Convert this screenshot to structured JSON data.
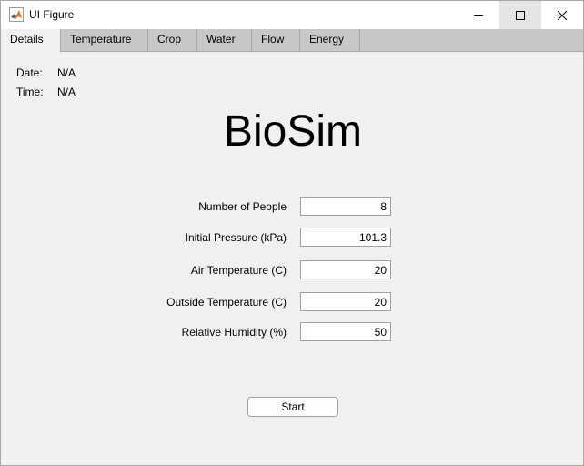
{
  "window": {
    "title": "UI Figure",
    "icon": "matlab-icon"
  },
  "tabs": [
    {
      "label": "Details",
      "active": true
    },
    {
      "label": "Temperature",
      "active": false
    },
    {
      "label": "Crop",
      "active": false
    },
    {
      "label": "Water",
      "active": false
    },
    {
      "label": "Flow",
      "active": false
    },
    {
      "label": "Energy",
      "active": false
    }
  ],
  "details": {
    "date_label": "Date:",
    "date_value": "N/A",
    "time_label": "Time:",
    "time_value": "N/A",
    "heading": "BioSim",
    "fields": [
      {
        "label": "Number of People",
        "value": "8"
      },
      {
        "label": "Initial Pressure (kPa)",
        "value": "101.3"
      },
      {
        "label": "Air Temperature (C)",
        "value": "20"
      },
      {
        "label": "Outside Temperature (C)",
        "value": "20"
      },
      {
        "label": "Relative Humidity (%)",
        "value": "50"
      }
    ],
    "start_label": "Start"
  },
  "colors": {
    "background": "#f0f0f0",
    "tabbar": "#c8c8c8",
    "border": "#a9a9a9"
  }
}
